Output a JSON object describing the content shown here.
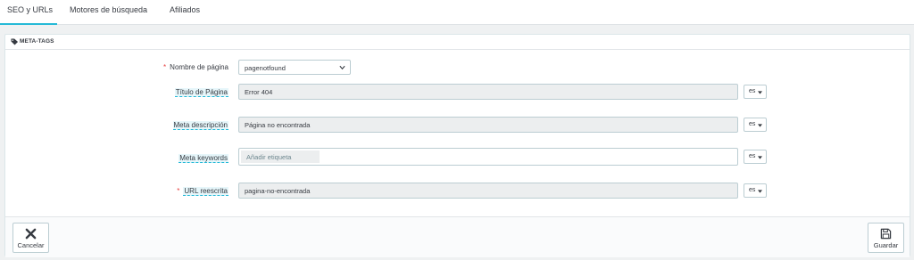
{
  "tabs": [
    {
      "label": "SEO y URLs",
      "active": true
    },
    {
      "label": "Motores de búsqueda",
      "active": false
    },
    {
      "label": "Afiliados",
      "active": false
    }
  ],
  "panel": {
    "title": "META-TAGS",
    "icon": "tag-icon",
    "fields": {
      "page_name": {
        "label": "Nombre de página",
        "required": true,
        "value": "pagenotfound"
      },
      "page_title": {
        "label": "Título de Página",
        "value": "Error 404",
        "lang": "es"
      },
      "meta_description": {
        "label": "Meta descripción",
        "value": "Página no encontrada",
        "lang": "es"
      },
      "meta_keywords": {
        "label": "Meta keywords",
        "placeholder": "Añadir etiqueta",
        "lang": "es"
      },
      "rewritten_url": {
        "label": "URL reescrita",
        "required": true,
        "value": "pagina-no-encontrada",
        "lang": "es"
      }
    }
  },
  "footer": {
    "cancel_label": "Cancelar",
    "save_label": "Guardar"
  },
  "colors": {
    "accent": "#25b9d7",
    "required": "#e73d3d"
  }
}
